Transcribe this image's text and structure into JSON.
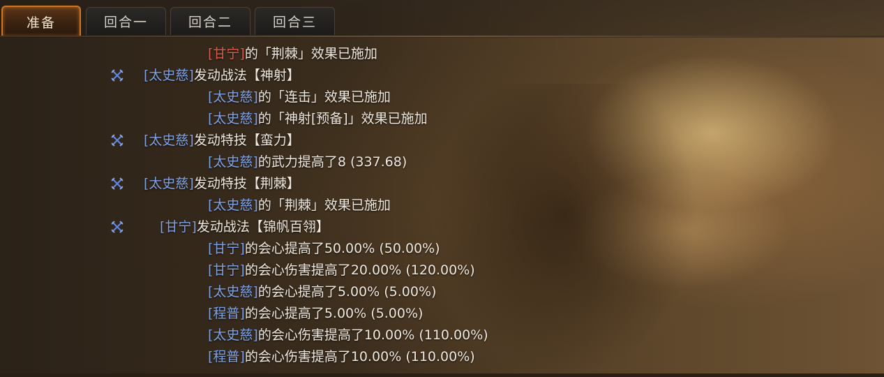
{
  "tabs": [
    {
      "label": "准备",
      "active": true
    },
    {
      "label": "回合一",
      "active": false
    },
    {
      "label": "回合二",
      "active": false
    },
    {
      "label": "回合三",
      "active": false
    }
  ],
  "colors": {
    "accent": "#d0761f",
    "ally_name": "#7ea2e6",
    "enemy_name": "#e25a4a",
    "text": "#efe9df"
  },
  "icon_name": "crossed-swords-icon",
  "log": [
    {
      "indent": 1,
      "icon": false,
      "name": "[甘宁]",
      "name_color": "red",
      "text": "的「荆棘」效果已施加"
    },
    {
      "indent": 0,
      "icon": true,
      "name": "[太史慈]",
      "name_color": "blue",
      "text": "发动战法【神射】"
    },
    {
      "indent": 1,
      "icon": false,
      "name": "[太史慈]",
      "name_color": "blue",
      "text": "的「连击」效果已施加"
    },
    {
      "indent": 1,
      "icon": false,
      "name": "[太史慈]",
      "name_color": "blue",
      "text": "的「神射[预备]」效果已施加"
    },
    {
      "indent": 0,
      "icon": true,
      "name": "[太史慈]",
      "name_color": "blue",
      "text": "发动特技【蛮力】"
    },
    {
      "indent": 1,
      "icon": false,
      "name": "[太史慈]",
      "name_color": "blue",
      "text": "的武力提高了8 (337.68)"
    },
    {
      "indent": 0,
      "icon": true,
      "name": "[太史慈]",
      "name_color": "blue",
      "text": "发动特技【荆棘】"
    },
    {
      "indent": 1,
      "icon": false,
      "name": "[太史慈]",
      "name_color": "blue",
      "text": "的「荆棘」效果已施加"
    },
    {
      "indent": 0,
      "icon": true,
      "name": "[甘宁]",
      "name_color": "blue",
      "text": "发动战法【锦帆百翎】",
      "shift": true
    },
    {
      "indent": 1,
      "icon": false,
      "name": "[甘宁]",
      "name_color": "blue",
      "text": "的会心提高了50.00% (50.00%)"
    },
    {
      "indent": 1,
      "icon": false,
      "name": "[甘宁]",
      "name_color": "blue",
      "text": "的会心伤害提高了20.00% (120.00%)"
    },
    {
      "indent": 1,
      "icon": false,
      "name": "[太史慈]",
      "name_color": "blue",
      "text": "的会心提高了5.00% (5.00%)"
    },
    {
      "indent": 1,
      "icon": false,
      "name": "[程普]",
      "name_color": "blue",
      "text": "的会心提高了5.00% (5.00%)"
    },
    {
      "indent": 1,
      "icon": false,
      "name": "[太史慈]",
      "name_color": "blue",
      "text": "的会心伤害提高了10.00% (110.00%)"
    },
    {
      "indent": 1,
      "icon": false,
      "name": "[程普]",
      "name_color": "blue",
      "text": "的会心伤害提高了10.00% (110.00%)"
    }
  ]
}
